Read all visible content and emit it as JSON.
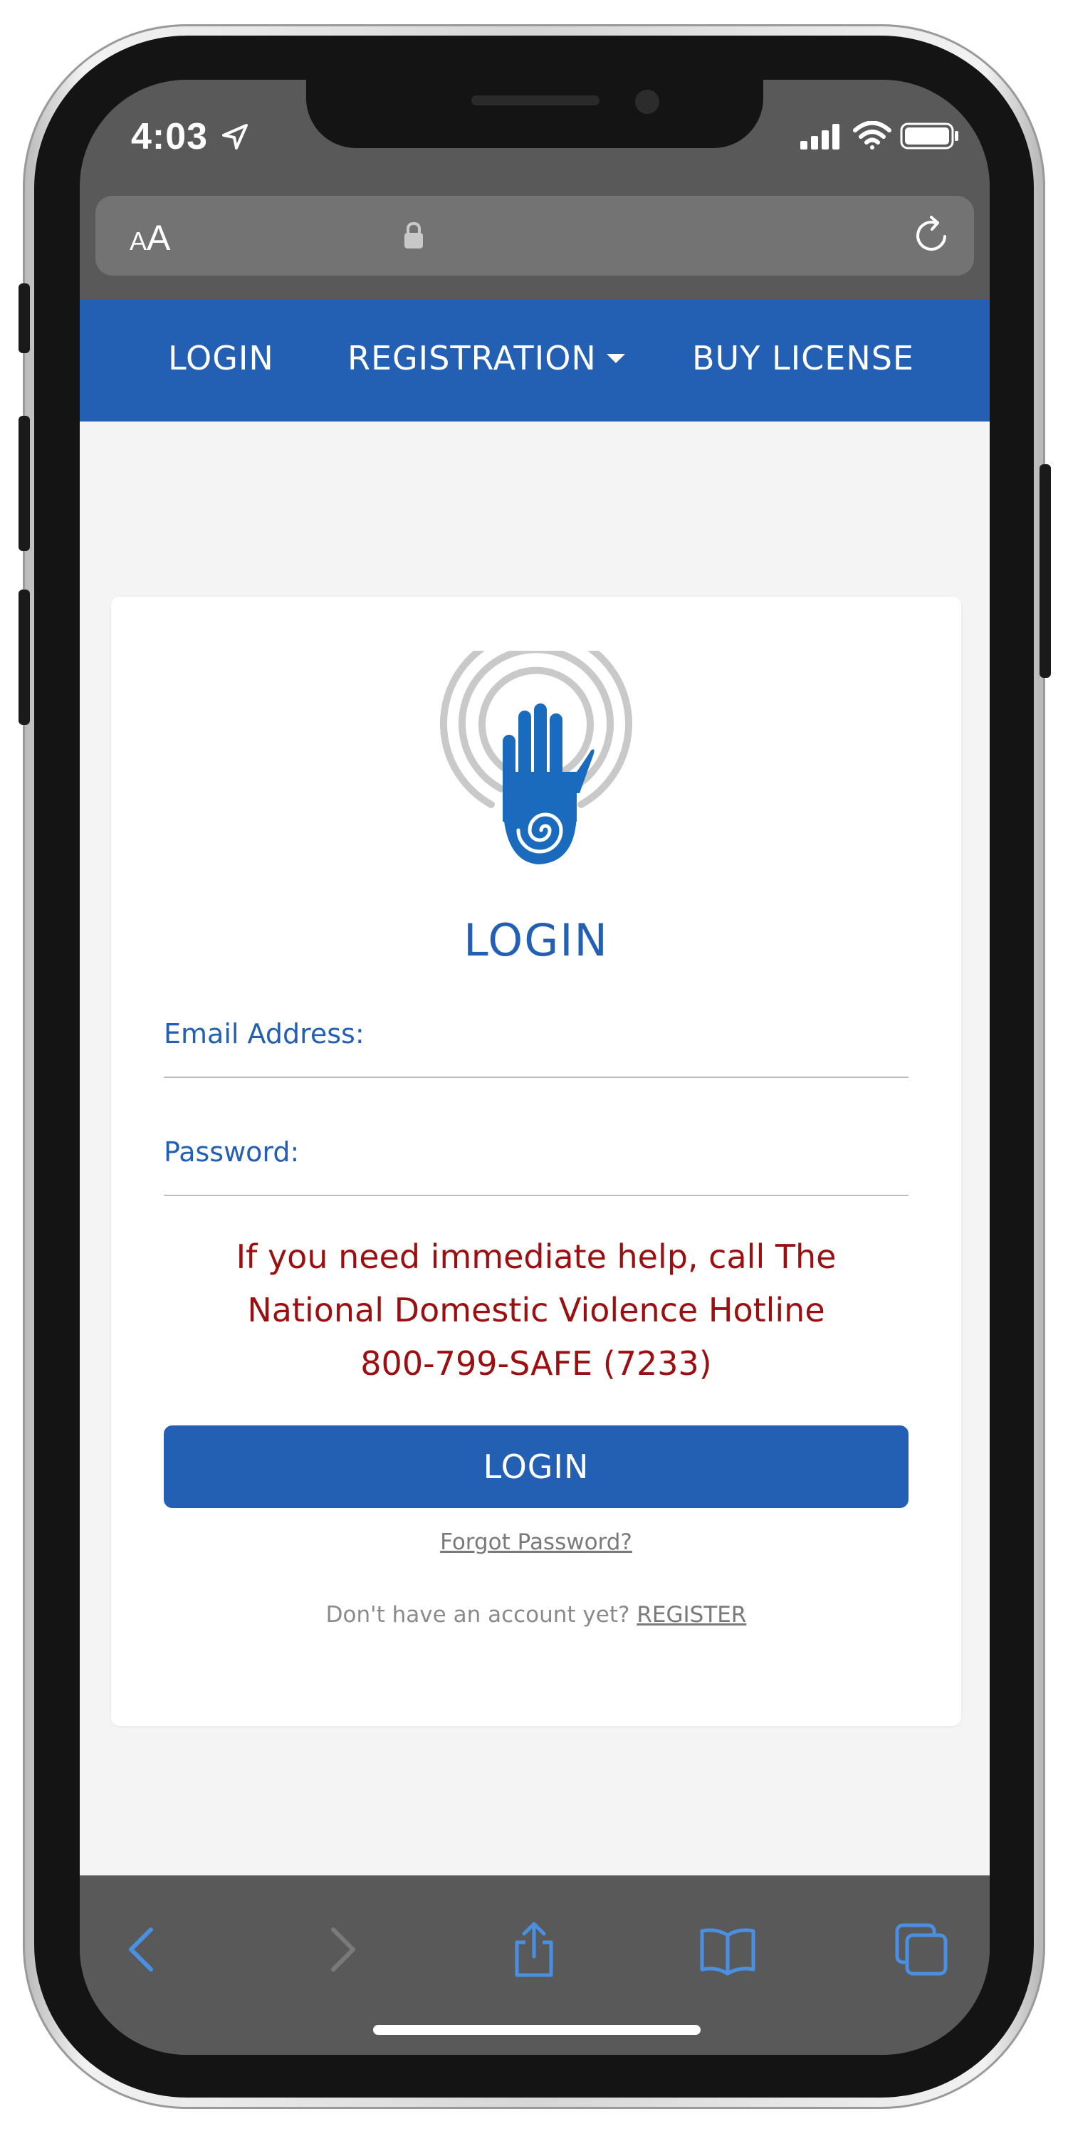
{
  "status_bar": {
    "time": "4:03"
  },
  "url_bar": {
    "aa_small": "A",
    "aa_big": "A"
  },
  "nav": {
    "login": "LOGIN",
    "registration": "REGISTRATION",
    "buy_license": "BUY LICENSE"
  },
  "login_card": {
    "title": "LOGIN",
    "email_label": "Email Address:",
    "email_value": "",
    "password_label": "Password:",
    "password_value": "",
    "help_line1": "If you need immediate help, call The",
    "help_line2": "National Domestic Violence Hotline",
    "help_line3": "800-799-SAFE (7233)",
    "login_button": "LOGIN",
    "forgot_password": "Forgot Password?",
    "no_account": "Don't have an account yet?",
    "register": "REGISTER"
  },
  "colors": {
    "nav_blue": "#235fb3",
    "alert_red": "#9b0f10",
    "toolbar_blue": "#4a90e2"
  },
  "icons": [
    "location-arrow-icon",
    "cellular-signal-icon",
    "wifi-icon",
    "battery-icon",
    "lock-icon",
    "reload-icon",
    "hand-logo-icon",
    "back-icon",
    "forward-icon",
    "share-icon",
    "bookmarks-icon",
    "tabs-icon"
  ]
}
